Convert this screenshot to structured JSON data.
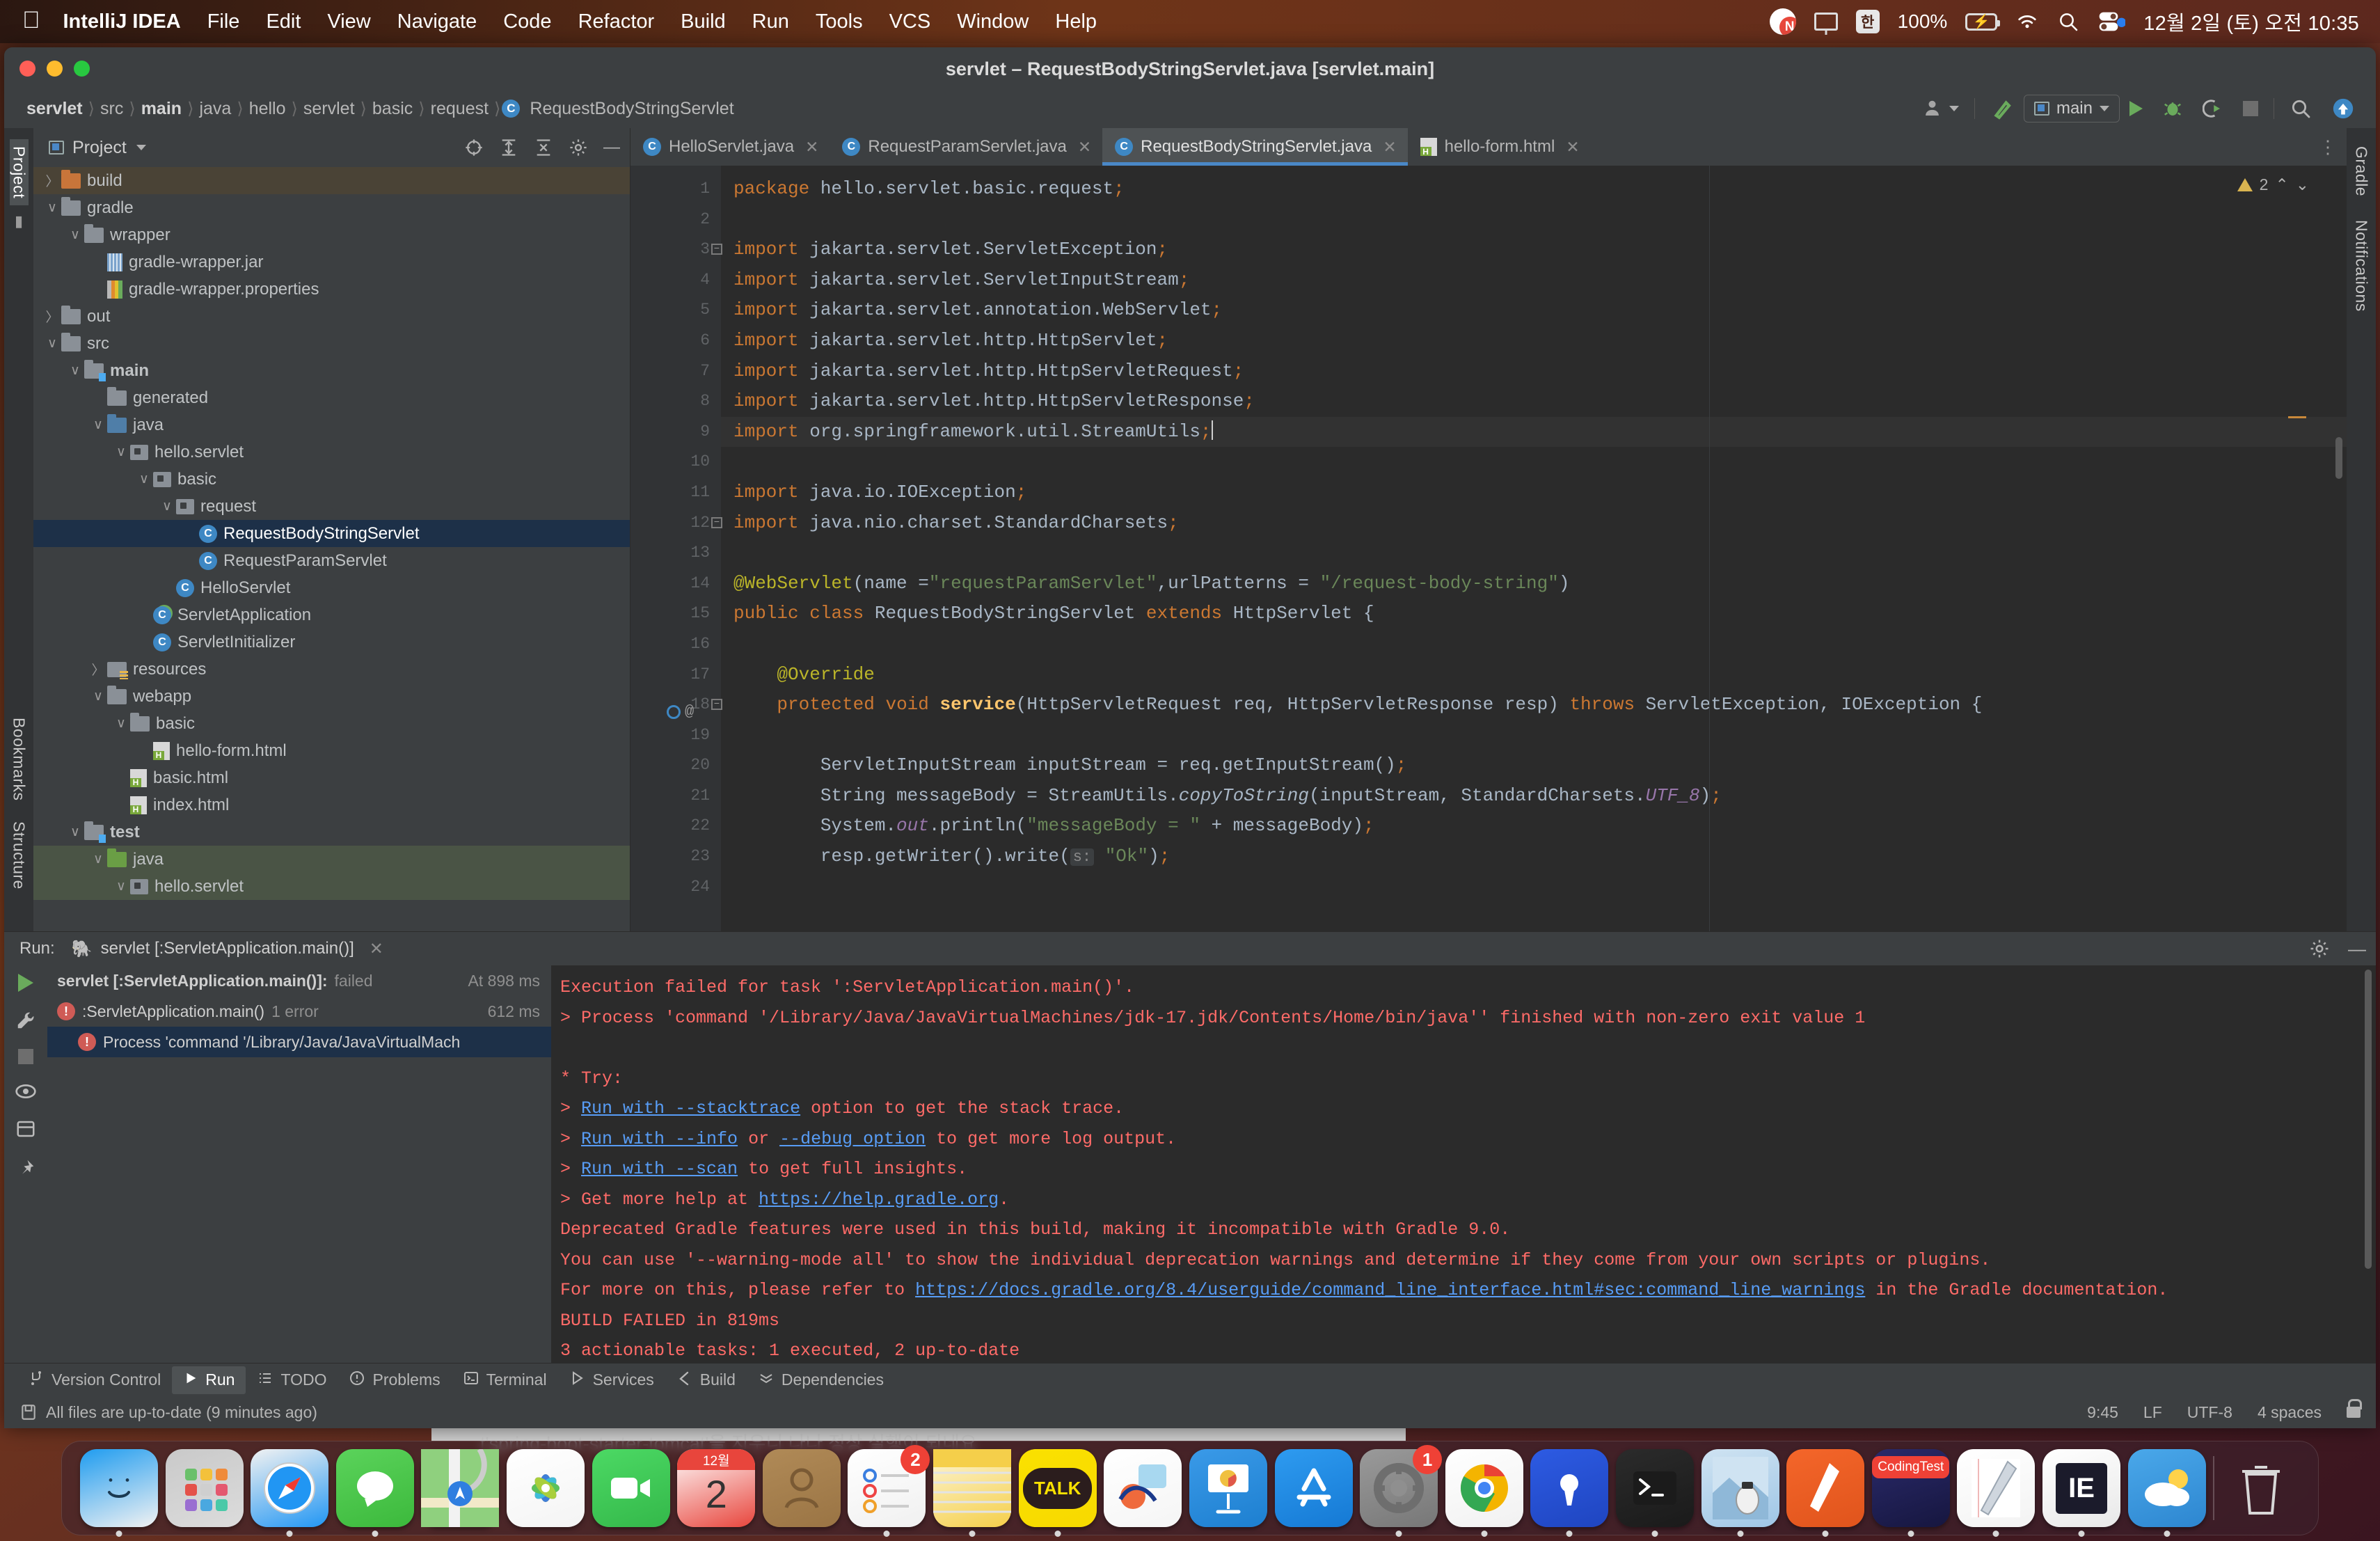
{
  "macbar": {
    "apple_icon": "apple-logo",
    "items": [
      {
        "label": "IntelliJ IDEA",
        "bold": true
      },
      {
        "label": "File",
        "bold": false
      },
      {
        "label": "Edit",
        "bold": false
      },
      {
        "label": "View",
        "bold": false
      },
      {
        "label": "Navigate",
        "bold": false
      },
      {
        "label": "Code",
        "bold": false
      },
      {
        "label": "Refactor",
        "bold": false
      },
      {
        "label": "Build",
        "bold": false
      },
      {
        "label": "Run",
        "bold": false
      },
      {
        "label": "Tools",
        "bold": false
      },
      {
        "label": "VCS",
        "bold": false
      },
      {
        "label": "Window",
        "bold": false
      },
      {
        "label": "Help",
        "bold": false
      }
    ],
    "status": {
      "naver_icon": "naver-icon",
      "display_icon": "display-icon",
      "input_source": "한",
      "battery_percent": "100%",
      "battery_icon": "battery-charging-icon",
      "wifi_icon": "wifi-icon",
      "search_icon": "spotlight-search-icon",
      "control_center_icon": "control-center-icon",
      "clock": "12월 2일 (토) 오전 10:35"
    }
  },
  "window": {
    "title": "servlet – RequestBodyStringServlet.java [servlet.main]"
  },
  "breadcrumb": {
    "items": [
      "servlet",
      "src",
      "main",
      "java",
      "hello",
      "servlet",
      "basic",
      "request"
    ],
    "bold_indices": [
      0,
      2
    ],
    "file": "RequestBodyStringServlet",
    "file_icon": "java-class-icon"
  },
  "toolbar": {
    "account_icon": "account-icon",
    "build_icon": "build-hammer-icon",
    "run_config": "main",
    "run_config_icon": "module-icon",
    "run_icon": "run-icon",
    "debug_icon": "debug-bug-icon",
    "coverage_icon": "run-with-coverage-icon",
    "stop_icon": "stop-icon",
    "search_icon": "search-everywhere-icon",
    "updates_icon": "updates-available-icon"
  },
  "rails": {
    "left": {
      "project_label": "Project",
      "bookmarks_label": "Bookmarks",
      "structure_label": "Structure"
    },
    "right": {
      "gradle_label": "Gradle",
      "notifications_label": "Notifications"
    }
  },
  "project_panel": {
    "title": "Project",
    "dropdown_icon": "chevron-down-icon",
    "icons": [
      "locate-icon",
      "expand-all-icon",
      "collapse-all-icon",
      "settings-gear-icon",
      "hide-icon"
    ],
    "tree": [
      {
        "label": "build",
        "indent": 1,
        "arrow": "collapsed",
        "icon": "folder-orange",
        "state": "build-highlight"
      },
      {
        "label": "gradle",
        "indent": 1,
        "arrow": "expanded",
        "icon": "folder-gray",
        "state": ""
      },
      {
        "label": "wrapper",
        "indent": 2,
        "arrow": "expanded",
        "icon": "folder-gray",
        "state": ""
      },
      {
        "label": "gradle-wrapper.jar",
        "indent": 3,
        "arrow": "none",
        "icon": "jar-file",
        "state": ""
      },
      {
        "label": "gradle-wrapper.properties",
        "indent": 3,
        "arrow": "none",
        "icon": "properties-file",
        "state": ""
      },
      {
        "label": "out",
        "indent": 1,
        "arrow": "collapsed",
        "icon": "folder-gray",
        "state": ""
      },
      {
        "label": "src",
        "indent": 1,
        "arrow": "expanded",
        "icon": "folder-gray",
        "state": ""
      },
      {
        "label": "main",
        "indent": 2,
        "arrow": "expanded",
        "icon": "folder-gray-mod",
        "state": "bold"
      },
      {
        "label": "generated",
        "indent": 3,
        "arrow": "none",
        "icon": "folder-gray",
        "state": ""
      },
      {
        "label": "java",
        "indent": 3,
        "arrow": "expanded",
        "icon": "folder-blue",
        "state": ""
      },
      {
        "label": "hello.servlet",
        "indent": 4,
        "arrow": "expanded",
        "icon": "package",
        "state": ""
      },
      {
        "label": "basic",
        "indent": 5,
        "arrow": "expanded",
        "icon": "package",
        "state": ""
      },
      {
        "label": "request",
        "indent": 6,
        "arrow": "expanded",
        "icon": "package",
        "state": ""
      },
      {
        "label": "RequestBodyStringServlet",
        "indent": 7,
        "arrow": "none",
        "icon": "java-class",
        "state": "selected"
      },
      {
        "label": "RequestParamServlet",
        "indent": 7,
        "arrow": "none",
        "icon": "java-class",
        "state": ""
      },
      {
        "label": "HelloServlet",
        "indent": 6,
        "arrow": "none",
        "icon": "java-class",
        "state": ""
      },
      {
        "label": "ServletApplication",
        "indent": 5,
        "arrow": "none",
        "icon": "java-class-runnable",
        "state": ""
      },
      {
        "label": "ServletInitializer",
        "indent": 5,
        "arrow": "none",
        "icon": "java-class",
        "state": ""
      },
      {
        "label": "resources",
        "indent": 3,
        "arrow": "collapsed",
        "icon": "folder-resources",
        "state": ""
      },
      {
        "label": "webapp",
        "indent": 3,
        "arrow": "expanded",
        "icon": "folder-gray",
        "state": ""
      },
      {
        "label": "basic",
        "indent": 4,
        "arrow": "expanded",
        "icon": "folder-gray",
        "state": ""
      },
      {
        "label": "hello-form.html",
        "indent": 5,
        "arrow": "none",
        "icon": "html-file",
        "state": ""
      },
      {
        "label": "basic.html",
        "indent": 4,
        "arrow": "none",
        "icon": "html-file",
        "state": ""
      },
      {
        "label": "index.html",
        "indent": 4,
        "arrow": "none",
        "icon": "html-file",
        "state": ""
      },
      {
        "label": "test",
        "indent": 2,
        "arrow": "expanded",
        "icon": "folder-gray-mod",
        "state": "bold"
      },
      {
        "label": "java",
        "indent": 3,
        "arrow": "expanded",
        "icon": "folder-green",
        "state": "test-highlight"
      },
      {
        "label": "hello.servlet",
        "indent": 4,
        "arrow": "expanded",
        "icon": "package",
        "state": "test-highlight"
      }
    ]
  },
  "editor": {
    "tabs": [
      {
        "label": "HelloServlet.java",
        "icon": "java-class-icon",
        "active": false
      },
      {
        "label": "RequestParamServlet.java",
        "icon": "java-class-icon",
        "active": false
      },
      {
        "label": "RequestBodyStringServlet.java",
        "icon": "java-class-icon",
        "active": true
      },
      {
        "label": "hello-form.html",
        "icon": "html-file-icon",
        "active": false
      }
    ],
    "tab_overflow_icon": "more-options-icon",
    "warning_count": "2",
    "warning_icon": "warning-triangle-icon",
    "inspection_up_icon": "chevron-up-icon",
    "inspection_down_icon": "chevron-down-icon",
    "lines": [
      {
        "n": "1",
        "text": "package hello.servlet.basic.request;"
      },
      {
        "n": "2",
        "text": ""
      },
      {
        "n": "3",
        "text": "import jakarta.servlet.ServletException;"
      },
      {
        "n": "4",
        "text": "import jakarta.servlet.ServletInputStream;"
      },
      {
        "n": "5",
        "text": "import jakarta.servlet.annotation.WebServlet;"
      },
      {
        "n": "6",
        "text": "import jakarta.servlet.http.HttpServlet;"
      },
      {
        "n": "7",
        "text": "import jakarta.servlet.http.HttpServletRequest;"
      },
      {
        "n": "8",
        "text": "import jakarta.servlet.http.HttpServletResponse;"
      },
      {
        "n": "9",
        "text": "import org.springframework.util.StreamUtils;"
      },
      {
        "n": "10",
        "text": ""
      },
      {
        "n": "11",
        "text": "import java.io.IOException;"
      },
      {
        "n": "12",
        "text": "import java.nio.charset.StandardCharsets;"
      },
      {
        "n": "13",
        "text": ""
      },
      {
        "n": "14",
        "text": "@WebServlet(name =\"requestParamServlet\",urlPatterns = \"/request-body-string\")"
      },
      {
        "n": "15",
        "text": "public class RequestBodyStringServlet extends HttpServlet {"
      },
      {
        "n": "16",
        "text": ""
      },
      {
        "n": "17",
        "text": "    @Override"
      },
      {
        "n": "18",
        "text": "    protected void service(HttpServletRequest req, HttpServletResponse resp) throws ServletException, IOException {"
      },
      {
        "n": "19",
        "text": ""
      },
      {
        "n": "20",
        "text": "        ServletInputStream inputStream = req.getInputStream();"
      },
      {
        "n": "21",
        "text": "        String messageBody = StreamUtils.copyToString(inputStream, StandardCharsets.UTF_8);"
      },
      {
        "n": "22",
        "text": "        System.out.println(\"messageBody = \" + messageBody);"
      },
      {
        "n": "23",
        "text": "        resp.getWriter().write( s: \"Ok\");"
      },
      {
        "n": "24",
        "text": ""
      }
    ],
    "param_hint": "s:"
  },
  "run_window": {
    "label": "Run:",
    "tab_title": "servlet [:ServletApplication.main()]",
    "tab_icon": "gradle-elephant-icon",
    "close_icon": "close-icon",
    "settings_icon": "settings-gear-icon",
    "hide_icon": "hide-icon",
    "rail_icons": [
      "rerun-icon",
      "settings-wrench-icon",
      "stop-icon",
      "eye-icon",
      "layout-icon",
      "pin-icon"
    ],
    "tree": [
      {
        "label": "servlet [:ServletApplication.main()]:",
        "suffix": "failed",
        "meta": "At 898 ms",
        "icon": "none",
        "bold": true,
        "selected": false,
        "indent": 0
      },
      {
        "label": ":ServletApplication.main()",
        "suffix": "1 error",
        "meta": "612 ms",
        "icon": "error-icon",
        "bold": false,
        "selected": false,
        "indent": 0
      },
      {
        "label": "Process 'command '/Library/Java/JavaVirtualMach",
        "suffix": "",
        "meta": "",
        "icon": "error-icon",
        "bold": false,
        "selected": true,
        "indent": 1
      }
    ],
    "console": [
      {
        "text": "Execution failed for task ':ServletApplication.main()'.",
        "link": ""
      },
      {
        "text": "> Process 'command '/Library/Java/JavaVirtualMachines/jdk-17.jdk/Contents/Home/bin/java'' finished with non-zero exit value 1",
        "link": ""
      },
      {
        "text": "",
        "link": ""
      },
      {
        "text": "* Try:",
        "link": ""
      },
      {
        "text": "> Run with --stacktrace option to get the stack trace.",
        "link": "Run with --stacktrace"
      },
      {
        "text": "> Run with --info or --debug option to get more log output.",
        "link": "Run with --info|--debug option"
      },
      {
        "text": "> Run with --scan to get full insights.",
        "link": "Run with --scan"
      },
      {
        "text": "> Get more help at https://help.gradle.org.",
        "link": "https://help.gradle.org"
      },
      {
        "text": "Deprecated Gradle features were used in this build, making it incompatible with Gradle 9.0.",
        "link": ""
      },
      {
        "text": "You can use '--warning-mode all' to show the individual deprecation warnings and determine if they come from your own scripts or plugins.",
        "link": ""
      },
      {
        "text": "For more on this, please refer to https://docs.gradle.org/8.4/userguide/command_line_interface.html#sec:command_line_warnings in the Gradle documentation.",
        "link": "https://docs.gradle.org/8.4/userguide/command_line_interface.html#sec:command_line_warnings"
      },
      {
        "text": "BUILD FAILED in 819ms",
        "link": ""
      },
      {
        "text": "3 actionable tasks: 1 executed, 2 up-to-date",
        "link": ""
      }
    ]
  },
  "bottom_bar": {
    "items": [
      {
        "label": "Version Control",
        "icon": "branch-icon",
        "active": false
      },
      {
        "label": "Run",
        "icon": "run-icon",
        "active": true
      },
      {
        "label": "TODO",
        "icon": "todo-list-icon",
        "active": false
      },
      {
        "label": "Problems",
        "icon": "problems-icon",
        "active": false
      },
      {
        "label": "Terminal",
        "icon": "terminal-icon",
        "active": false
      },
      {
        "label": "Services",
        "icon": "services-icon",
        "active": false
      },
      {
        "label": "Build",
        "icon": "build-icon",
        "active": false
      },
      {
        "label": "Dependencies",
        "icon": "dependencies-icon",
        "active": false
      }
    ]
  },
  "status_bar": {
    "message": "All files are up-to-date (9 minutes ago)",
    "message_icon": "save-status-icon",
    "caret_position": "9:45",
    "line_separator": "LF",
    "encoding": "UTF-8",
    "indent": "4 spaces",
    "lock_icon": "unlocked-icon"
  },
  "behind_window": {
    "text": "t'spring-boot-starter-tomcat'을 지우니 나나 정상 실행이 되네요"
  },
  "dock": {
    "apps": [
      {
        "name": "finder-icon",
        "glyph": "",
        "color1": "#1f9cf0",
        "color2": "#f2f2f2",
        "running": true,
        "badge": ""
      },
      {
        "name": "launchpad-icon",
        "glyph": "",
        "color1": "#c9c9c9",
        "color2": "#dcdcdc",
        "running": false,
        "badge": ""
      },
      {
        "name": "safari-icon",
        "glyph": "",
        "color1": "#f2f2f2",
        "color2": "#2196f3",
        "running": true,
        "badge": ""
      },
      {
        "name": "messages-icon",
        "glyph": "",
        "color1": "#5bd35b",
        "color2": "#3cb93c",
        "running": true,
        "badge": ""
      },
      {
        "name": "maps-icon",
        "glyph": "",
        "color1": "#8fd07e",
        "color2": "#5fae53",
        "running": false,
        "badge": ""
      },
      {
        "name": "photos-icon",
        "glyph": "",
        "color1": "#ffffff",
        "color2": "#f4f4f4",
        "running": false,
        "badge": ""
      },
      {
        "name": "facetime-icon",
        "glyph": "",
        "color1": "#4cd964",
        "color2": "#34b84a",
        "running": false,
        "badge": ""
      },
      {
        "name": "calendar-icon",
        "glyph": "2",
        "color1": "#ffffff",
        "color2": "#e8453c",
        "running": false,
        "badge": "",
        "top_label": "12월"
      },
      {
        "name": "contacts-icon",
        "glyph": "",
        "color1": "#b08a57",
        "color2": "#9a7444",
        "running": false,
        "badge": ""
      },
      {
        "name": "reminders-icon",
        "glyph": "",
        "color1": "#ffffff",
        "color2": "#f0f0f0",
        "running": true,
        "badge": "2"
      },
      {
        "name": "notes-icon",
        "glyph": "",
        "color1": "#fdf6d8",
        "color2": "#f5cf4a",
        "running": true,
        "badge": ""
      },
      {
        "name": "kakaotalk-icon",
        "glyph": "TALK",
        "color1": "#fae100",
        "color2": "#f7d900",
        "running": true,
        "badge": ""
      },
      {
        "name": "freeform-icon",
        "glyph": "",
        "color1": "#ffffff",
        "color2": "#f5f5f5",
        "running": false,
        "badge": ""
      },
      {
        "name": "keynote-icon",
        "glyph": "",
        "color1": "#3a9ae8",
        "color2": "#1d7fd0",
        "running": false,
        "badge": ""
      },
      {
        "name": "app-store-icon",
        "glyph": "",
        "color1": "#2e9bf0",
        "color2": "#1579d4",
        "running": false,
        "badge": ""
      },
      {
        "name": "system-settings-icon",
        "glyph": "",
        "color1": "#9a9a9a",
        "color2": "#777777",
        "running": true,
        "badge": "1"
      },
      {
        "name": "chrome-icon",
        "glyph": "",
        "color1": "#ffffff",
        "color2": "#f1f1f1",
        "running": true,
        "badge": ""
      },
      {
        "name": "postman-icon",
        "glyph": "",
        "color1": "#2d5be3",
        "color2": "#1f45c0",
        "running": true,
        "badge": ""
      },
      {
        "name": "terminal-icon",
        "glyph": "",
        "color1": "#2b2b2b",
        "color2": "#1a1a1a",
        "running": true,
        "badge": ""
      },
      {
        "name": "preview-icon",
        "glyph": "",
        "color1": "#cfe3f2",
        "color2": "#9fc6e6",
        "running": true,
        "badge": ""
      },
      {
        "name": "sketch-pen-icon",
        "glyph": "",
        "color1": "#f4662a",
        "color2": "#e0541c",
        "running": true,
        "badge": ""
      },
      {
        "name": "codingtest-icon",
        "glyph": "CodingTest",
        "color1": "#2a2a6a",
        "color2": "#16163f",
        "running": true,
        "badge": ""
      },
      {
        "name": "notability-icon",
        "glyph": "",
        "color1": "#ffffff",
        "color2": "#f3f3f3",
        "running": true,
        "badge": ""
      },
      {
        "name": "intellij-idea-icon",
        "glyph": "IE",
        "color1": "#ffffff",
        "color2": "#e8e8e8",
        "running": true,
        "badge": ""
      },
      {
        "name": "weather-icon",
        "glyph": "",
        "color1": "#4aa8ea",
        "color2": "#2d86d0",
        "running": true,
        "badge": ""
      },
      {
        "name": "trash-icon",
        "glyph": "",
        "color1": "#bbbbbb",
        "color2": "#8f8f8f",
        "running": false,
        "badge": ""
      }
    ]
  }
}
